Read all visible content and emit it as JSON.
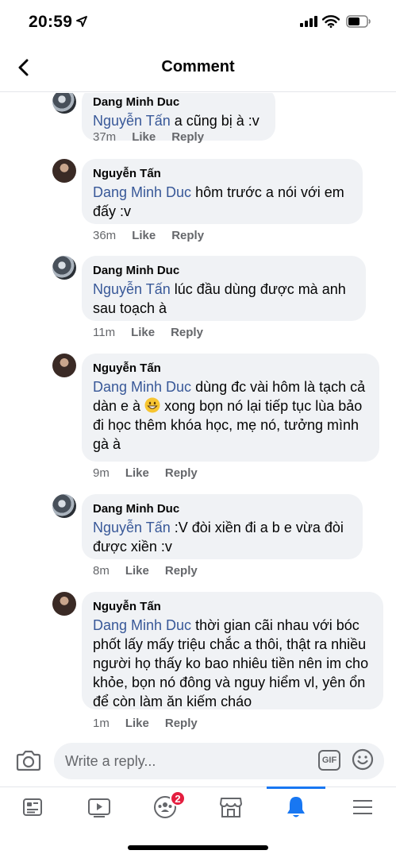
{
  "status_bar": {
    "time": "20:59"
  },
  "header": {
    "title": "Comment"
  },
  "comments": [
    {
      "author": "Dang Minh Duc",
      "mention": "Nguyễn Tấn",
      "text": " a cũng bị à :v",
      "time": "37m",
      "like": "Like",
      "reply": "Reply"
    },
    {
      "author": "Nguyễn Tấn",
      "mention": "Dang Minh Duc",
      "text": " hôm trước a nói với em đấy :v",
      "time": "36m",
      "like": "Like",
      "reply": "Reply"
    },
    {
      "author": "Dang Minh Duc",
      "mention": "Nguyễn Tấn",
      "text": " lúc đầu dùng được mà anh sau toạch à",
      "time": "11m",
      "like": "Like",
      "reply": "Reply"
    },
    {
      "author": "Nguyễn Tấn",
      "mention": "Dang Minh Duc",
      "text_before_emoji": " dùng đc vài hôm là tạch cả dàn e à ",
      "text_after_emoji": " xong bọn nó lại tiếp tục lùa bảo đi học thêm khóa học, mẹ nó, tưởng mình gà à",
      "time": "9m",
      "like": "Like",
      "reply": "Reply"
    },
    {
      "author": "Dang Minh Duc",
      "mention": "Nguyễn Tấn",
      "text": " :V đòi xiền đi a b e vừa đòi được xiền :v",
      "time": "8m",
      "like": "Like",
      "reply": "Reply"
    },
    {
      "author": "Nguyễn Tấn",
      "mention": "Dang Minh Duc",
      "text": " thời gian cãi nhau với bóc phốt lấy mấy triệu chắc a thôi, thật ra nhiều người họ thấy ko bao nhiêu tiền nên im cho khỏe, bọn nó đông và nguy hiểm vl, yên ổn để còn làm ăn kiếm cháo",
      "time": "1m",
      "like": "Like",
      "reply": "Reply"
    }
  ],
  "reply_bar": {
    "placeholder": "Write a reply...",
    "gif_label": "GIF"
  },
  "tab_bar": {
    "tabs": [
      "news-feed",
      "watch",
      "groups",
      "marketplace",
      "notifications",
      "menu"
    ],
    "active_tab": "notifications",
    "groups_badge": "2"
  },
  "colors": {
    "accent": "#1877f2",
    "mention": "#385898",
    "bubble": "#f0f2f5",
    "badge": "#e41e3f"
  }
}
